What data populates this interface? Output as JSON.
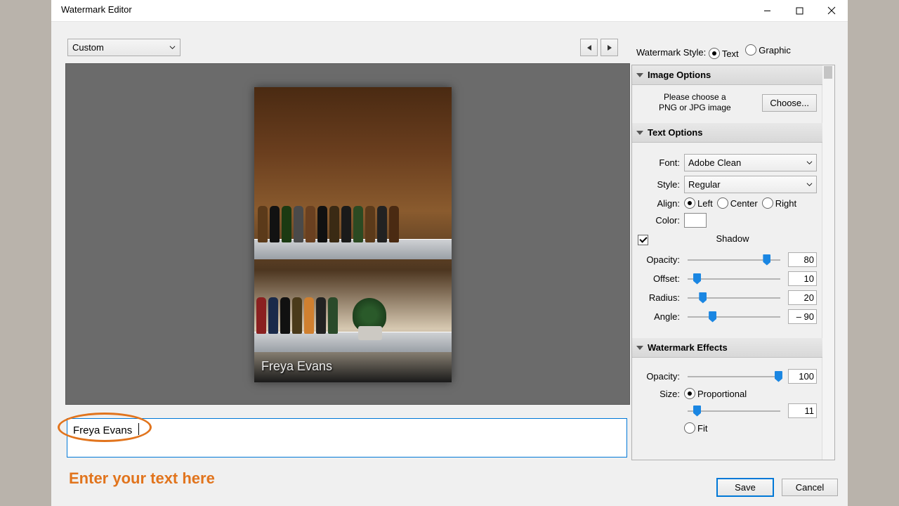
{
  "window": {
    "title": "Watermark Editor"
  },
  "preset": {
    "value": "Custom"
  },
  "style": {
    "label": "Watermark Style:",
    "opt1": "Text",
    "opt2": "Graphic",
    "selected": "Text"
  },
  "preview": {
    "watermark_text": "Freya Evans"
  },
  "text_input": {
    "value": "Freya Evans"
  },
  "hint": "Enter your text here",
  "footer": {
    "save": "Save",
    "cancel": "Cancel"
  },
  "panel": {
    "image_options": {
      "title": "Image Options",
      "instructions_l1": "Please choose a",
      "instructions_l2": "PNG or JPG image",
      "choose": "Choose..."
    },
    "text_options": {
      "title": "Text Options",
      "font_label": "Font:",
      "font_value": "Adobe Clean",
      "style_label": "Style:",
      "style_value": "Regular",
      "align_label": "Align:",
      "align_left": "Left",
      "align_center": "Center",
      "align_right": "Right",
      "color_label": "Color:",
      "shadow_label": "Shadow",
      "opacity_label": "Opacity:",
      "opacity_value": "80",
      "offset_label": "Offset:",
      "offset_value": "10",
      "radius_label": "Radius:",
      "radius_value": "20",
      "angle_label": "Angle:",
      "angle_value": "– 90"
    },
    "effects": {
      "title": "Watermark Effects",
      "opacity_label": "Opacity:",
      "opacity_value": "100",
      "size_label": "Size:",
      "proportional": "Proportional",
      "size_value": "11",
      "fit": "Fit"
    }
  }
}
